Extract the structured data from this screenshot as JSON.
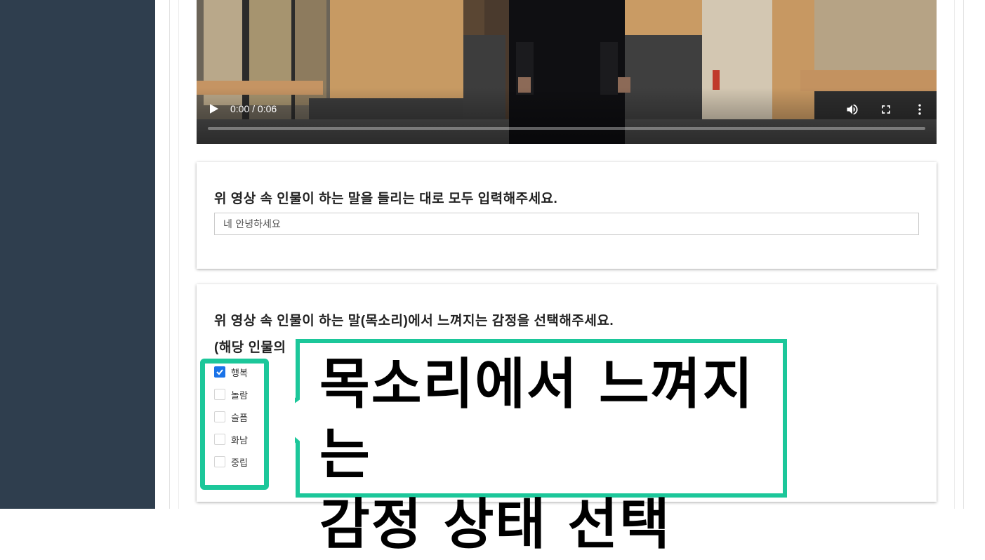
{
  "video": {
    "time": "0:00 / 0:06",
    "progress": 0.0
  },
  "question1": {
    "title": "위 영상 속 인물이 하는 말을 들리는 대로 모두 입력해주세요.",
    "input_value": "네 안녕하세요"
  },
  "question2": {
    "title": "위 영상 속 인물이 하는 말(목소리)에서 느껴지는 감정을 선택해주세요.",
    "subtitle": "(해당 인물의",
    "options": [
      {
        "label": "행복",
        "checked": true
      },
      {
        "label": "놀람",
        "checked": false
      },
      {
        "label": "슬픔",
        "checked": false
      },
      {
        "label": "화남",
        "checked": false
      },
      {
        "label": "중립",
        "checked": false
      }
    ]
  },
  "annotation": {
    "line1": "목소리에서 느껴지는",
    "line2": "감정 상태 선택",
    "color": "#1cc79a"
  }
}
